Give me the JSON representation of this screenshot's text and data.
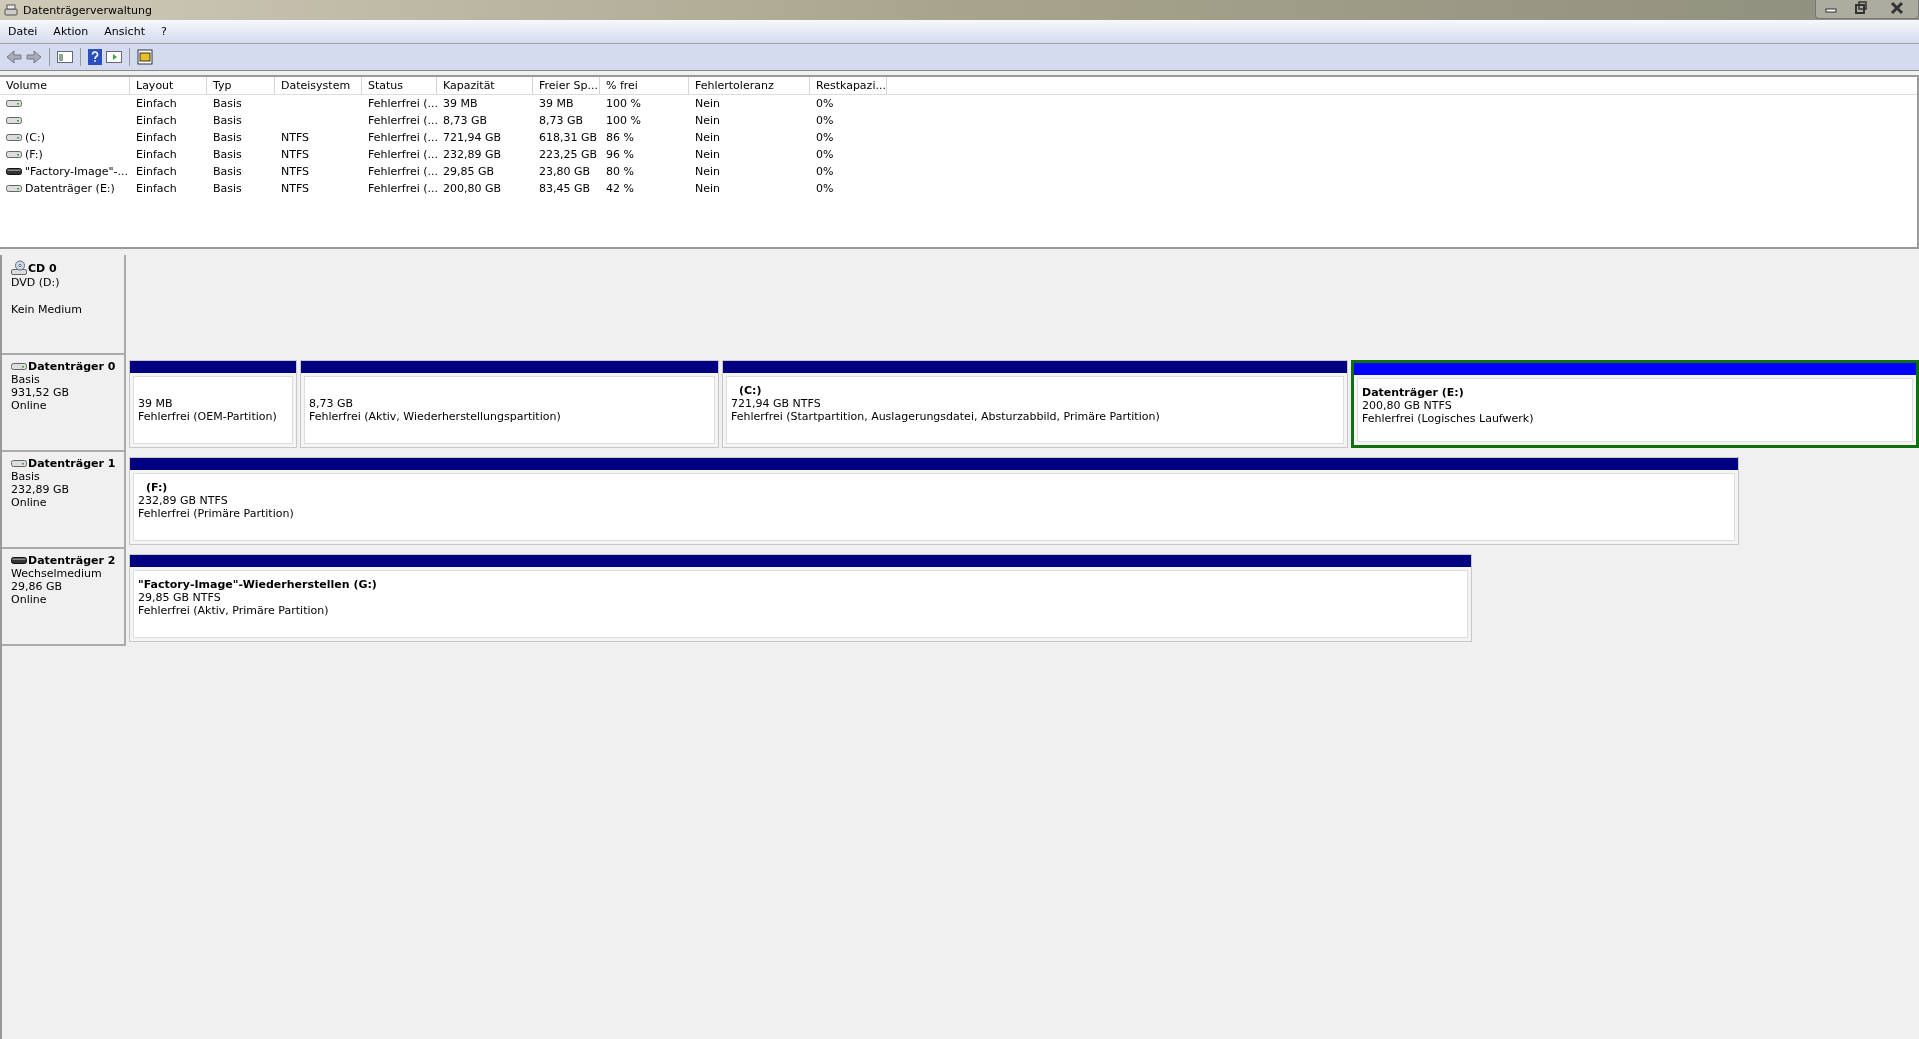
{
  "window": {
    "title": "Datenträgerverwaltung"
  },
  "menu": [
    "Datei",
    "Aktion",
    "Ansicht",
    "?"
  ],
  "table": {
    "columns": [
      "Volume",
      "Layout",
      "Typ",
      "Dateisystem",
      "Status",
      "Kapazität",
      "Freier Sp...",
      "% frei",
      "Fehlertoleranz",
      "Restkapazi..."
    ],
    "rows": [
      {
        "kind": "fixed",
        "cells": [
          "",
          "Einfach",
          "Basis",
          "",
          "Fehlerfrei (...",
          "39 MB",
          "39 MB",
          "100 %",
          "Nein",
          "0%"
        ]
      },
      {
        "kind": "fixed",
        "cells": [
          "",
          "Einfach",
          "Basis",
          "",
          "Fehlerfrei (...",
          "8,73 GB",
          "8,73 GB",
          "100 %",
          "Nein",
          "0%"
        ]
      },
      {
        "kind": "fixed",
        "cells": [
          "(C:)",
          "Einfach",
          "Basis",
          "NTFS",
          "Fehlerfrei (...",
          "721,94 GB",
          "618,31 GB",
          "86 %",
          "Nein",
          "0%"
        ]
      },
      {
        "kind": "fixed",
        "cells": [
          "(F:)",
          "Einfach",
          "Basis",
          "NTFS",
          "Fehlerfrei (...",
          "232,89 GB",
          "223,25 GB",
          "96 %",
          "Nein",
          "0%"
        ]
      },
      {
        "kind": "removable",
        "cells": [
          "\"Factory-Image\"-...",
          "Einfach",
          "Basis",
          "NTFS",
          "Fehlerfrei (...",
          "29,85 GB",
          "23,80 GB",
          "80 %",
          "Nein",
          "0%"
        ]
      },
      {
        "kind": "fixed",
        "cells": [
          "Datenträger (E:)",
          "Einfach",
          "Basis",
          "NTFS",
          "Fehlerfrei (...",
          "200,80 GB",
          "83,45 GB",
          "42 %",
          "Nein",
          "0%"
        ]
      }
    ]
  },
  "disks": [
    {
      "kind": "cd",
      "name": "CD 0",
      "lines": [
        "DVD (D:)",
        "Kein Medium"
      ]
    },
    {
      "kind": "fixed",
      "name": "Datenträger 0",
      "lines": [
        "Basis",
        "931,52 GB",
        "Online"
      ],
      "partitions": [
        {
          "kind": "primary",
          "selected": false,
          "lines": [
            "39 MB",
            "Fehlerfrei (OEM-Partition)"
          ]
        },
        {
          "kind": "primary",
          "selected": false,
          "lines": [
            "8,73 GB",
            "Fehlerfrei (Aktiv, Wiederherstellungspartition)"
          ]
        },
        {
          "kind": "primary",
          "selected": false,
          "label": "(C:)",
          "lines": [
            "721,94 GB NTFS",
            "Fehlerfrei (Startpartition, Auslagerungsdatei, Absturzabbild, Primäre Partition)"
          ]
        },
        {
          "kind": "logical",
          "selected": true,
          "label": "Datenträger  (E:)",
          "lines": [
            "200,80 GB NTFS",
            "Fehlerfrei (Logisches Laufwerk)"
          ]
        }
      ]
    },
    {
      "kind": "fixed",
      "name": "Datenträger 1",
      "lines": [
        "Basis",
        "232,89 GB",
        "Online"
      ],
      "partitions": [
        {
          "kind": "primary",
          "selected": false,
          "label": "(F:)",
          "lines": [
            "232,89 GB NTFS",
            "Fehlerfrei (Primäre Partition)"
          ]
        }
      ]
    },
    {
      "kind": "removable",
      "name": "Datenträger 2",
      "lines": [
        "Wechselmedium",
        "29,86 GB",
        "Online"
      ],
      "partitions": [
        {
          "kind": "primary",
          "selected": false,
          "label": "\"Factory-Image\"-Wiederherstellen  (G:)",
          "lines": [
            "29,85 GB NTFS",
            "Fehlerfrei (Aktiv, Primäre Partition)"
          ]
        }
      ]
    }
  ]
}
